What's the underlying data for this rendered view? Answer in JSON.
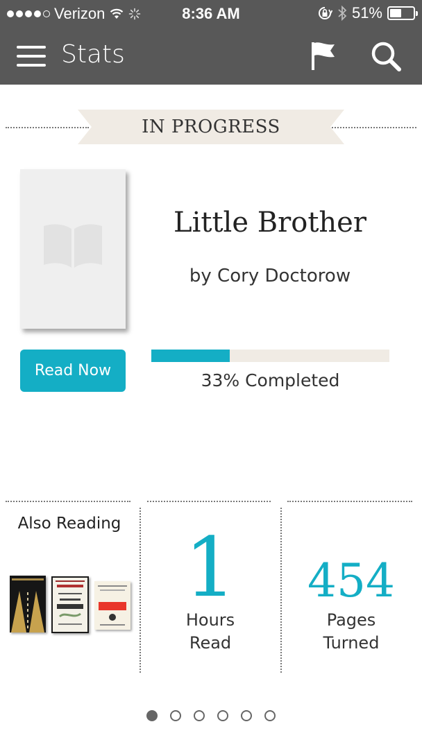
{
  "status_bar": {
    "carrier": "Verizon",
    "time": "8:36 AM",
    "battery": "51%",
    "battery_level": 0.51,
    "signal_bars": 4,
    "icons": [
      "wifi-icon",
      "activity-spinner-icon",
      "orientation-lock-icon",
      "bluetooth-icon",
      "battery-icon"
    ]
  },
  "nav": {
    "title": "Stats",
    "icons": [
      "menu-icon",
      "flag-icon",
      "search-icon"
    ]
  },
  "section": {
    "title": "IN PROGRESS"
  },
  "book": {
    "title": "Little Brother",
    "author": "by Cory Doctorow",
    "cover_icon": "book-icon",
    "read_button": "Read Now",
    "progress_percent": 33,
    "progress_label": "33% Completed"
  },
  "also_reading": {
    "title": "Also Reading",
    "books": [
      {
        "title": "MASTERY",
        "cover_color": "#1a1a1a"
      },
      {
        "title": "MINDS",
        "cover_color": "#f4f1e8"
      },
      {
        "title": "what if?",
        "cover_color": "#f6f1e4"
      }
    ]
  },
  "stats": [
    {
      "value": "1",
      "label_line1": "Hours",
      "label_line2": "Read"
    },
    {
      "value": "454",
      "label_line1": "Pages",
      "label_line2": "Turned"
    }
  ],
  "pagination": {
    "total": 6,
    "active_index": 0
  },
  "colors": {
    "accent": "#14aec5",
    "bar": "#585858",
    "ribbon": "#f0ebe4"
  }
}
